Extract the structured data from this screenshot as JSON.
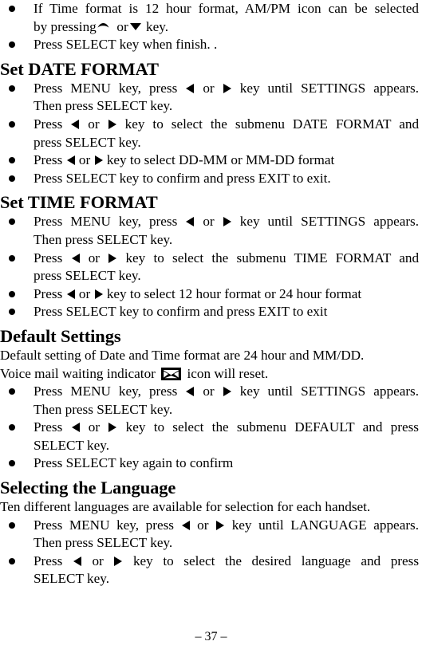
{
  "document": {
    "page_number_label": "– 37 –"
  },
  "intro_bullets": [
    {
      "lines": [
        "If Time format is 12 hour format, AM/PM icon can be selected",
        "by pressing",
        "or",
        "key."
      ],
      "glyph_up": "up-arrow-icon",
      "glyph_down": "down-arrow-icon"
    },
    {
      "text": "Press SELECT key when finish.    ."
    }
  ],
  "sections": [
    {
      "heading": "Set DATE FORMAT",
      "paragraphs": [],
      "bullets": [
        {
          "line1_a": "Press MENU key, press",
          "line1_mid": "or",
          "line1_b": "key until SETTINGS appears.",
          "line2": "Then press SELECT key."
        },
        {
          "line1_a": "Press",
          "line1_mid": "or",
          "line1_b": "key to select the submenu DATE FORMAT and",
          "line2": "press SELECT key."
        },
        {
          "line1_a": "Press",
          "line1_mid": "or",
          "line1_b": "key to select DD-MM or MM-DD format"
        },
        {
          "line1_a": "Press SELECT key to confirm and press EXIT to exit."
        }
      ]
    },
    {
      "heading": "Set TIME FORMAT",
      "paragraphs": [],
      "bullets": [
        {
          "line1_a": "Press MENU key, press",
          "line1_mid": "or",
          "line1_b": "key until SETTINGS appears.",
          "line2": "Then press SELECT key."
        },
        {
          "line1_a": "Press",
          "line1_mid": "or",
          "line1_b": "key to select the submenu TIME FORMAT and",
          "line2": "press SELECT key."
        },
        {
          "line1_a": "Press",
          "line1_mid": "or",
          "line1_b": "key to select 12 hour format or 24 hour format"
        },
        {
          "line1_a": "Press SELECT key to confirm and press EXIT to exit"
        }
      ]
    },
    {
      "heading": "Default Settings",
      "paragraphs": [
        "Default setting of Date and Time format are 24 hour and MM/DD.",
        {
          "before_icon": "Voice mail waiting indicator",
          "icon": "voicemail-envelope-icon",
          "after_icon": "icon will reset."
        }
      ],
      "bullets": [
        {
          "line1_a": "Press MENU key, press",
          "line1_mid": "or",
          "line1_b": "key until SETTINGS appears.",
          "line2": "Then press SELECT key."
        },
        {
          "line1_a": "Press",
          "line1_mid": "or",
          "line1_b": "key to select the submenu DEFAULT and press",
          "line2": "SELECT key."
        },
        {
          "line1_a": "Press SELECT key again to confirm"
        }
      ]
    },
    {
      "heading": "Selecting the Language",
      "paragraphs": [
        "Ten different languages are available for selection for each handset."
      ],
      "bullets": [
        {
          "line1_a": "Press MENU key, press",
          "line1_mid": "or",
          "line1_b": "key until LANGUAGE appears.",
          "line2": "Then press SELECT key."
        },
        {
          "line1_a": "Press",
          "line1_mid": "or",
          "line1_b": "key to select the desired language and press",
          "line2": "SELECT key."
        }
      ]
    }
  ]
}
